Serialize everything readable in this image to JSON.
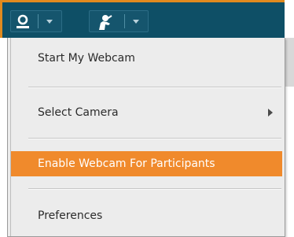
{
  "toolbar": {
    "buttons": [
      {
        "icon": "user-icon"
      },
      {
        "icon": "webcam-presenter-icon"
      }
    ]
  },
  "menu": {
    "items": [
      {
        "label": "Start My Webcam"
      },
      {
        "label": "Select Camera",
        "has_submenu": true
      },
      {
        "label": "Enable Webcam For Participants",
        "highlighted": true
      },
      {
        "label": "Preferences"
      }
    ]
  },
  "colors": {
    "toolbar_bg": "#0e4f66",
    "highlight": "#f08a2c",
    "menu_bg": "#ececec",
    "accent_border": "#e08a1f"
  }
}
